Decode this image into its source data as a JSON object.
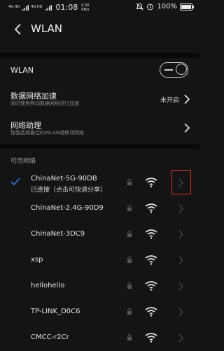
{
  "status_bar": {
    "signal_1": "4G HD",
    "signal_2": "4G HD",
    "time": "01:08",
    "speed_value": "0.30",
    "speed_unit": "KB/s",
    "battery": "100%",
    "battery_level_percent": 100
  },
  "header": {
    "title": "WLAN"
  },
  "wlan_toggle": {
    "label": "WLAN",
    "state": "on"
  },
  "data_boost": {
    "label": "数据网络加速",
    "sub": "同时使用移动数据网络进行加速",
    "value": "未开启"
  },
  "assistant": {
    "label": "网络助理",
    "sub": "智能选择最佳的WLAN或移动网络"
  },
  "available": {
    "label": "可用网络",
    "networks": [
      {
        "name": "ChinaNet-5G-90DB",
        "status": "已连接（点击可快速分享）",
        "connected": true
      },
      {
        "name": "ChinaNet-2.4G-90D9"
      },
      {
        "name": "ChinaNet-3DC9"
      },
      {
        "name": "xsp"
      },
      {
        "name": "hellohello"
      },
      {
        "name": "TP-LINK_D0C6"
      },
      {
        "name": "CMCC-r2Cr"
      }
    ]
  },
  "colors": {
    "background": "#141414",
    "separator": "#0a0a0a",
    "check": "#3e7bd4",
    "highlight": "#e0342b"
  },
  "icons": [
    "back-arrow-icon",
    "mute-icon",
    "alarm-icon",
    "battery-icon",
    "toggle-icon",
    "chevron-right-icon",
    "check-icon",
    "lock-icon",
    "wifi-signal-icon"
  ]
}
